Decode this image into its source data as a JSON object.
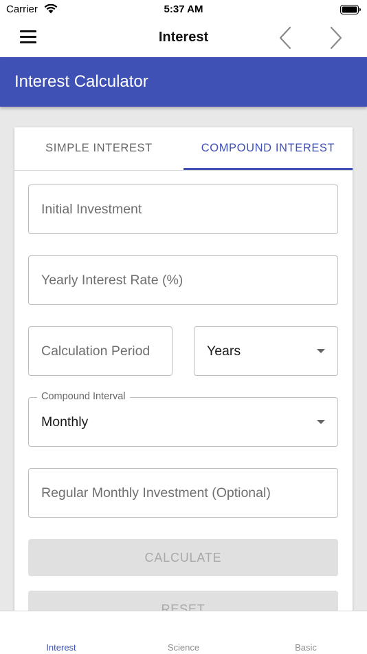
{
  "status_bar": {
    "carrier": "Carrier",
    "time": "5:37 AM",
    "icons": [
      "wifi-icon",
      "battery-icon"
    ]
  },
  "nav_bar": {
    "title": "Interest",
    "icons": [
      "menu-icon",
      "chevron-left-icon",
      "chevron-right-icon"
    ]
  },
  "header": {
    "title": "Interest Calculator",
    "color": "#3f51b5"
  },
  "tabs": {
    "simple": "SIMPLE INTEREST",
    "compound": "COMPOUND INTEREST",
    "active": "COMPOUND INTEREST"
  },
  "form": {
    "initial_investment": {
      "placeholder": "Initial Investment",
      "value": ""
    },
    "yearly_rate": {
      "placeholder": "Yearly Interest Rate (%)",
      "value": ""
    },
    "calculation_period": {
      "placeholder": "Calculation Period",
      "value": ""
    },
    "period_unit": {
      "value": "Years"
    },
    "compound_interval": {
      "label": "Compound Interval",
      "value": "Monthly"
    },
    "monthly_investment": {
      "placeholder": "Regular Monthly Investment (Optional)",
      "value": ""
    }
  },
  "buttons": {
    "calculate": "CALCULATE",
    "reset": "RESET"
  },
  "bottom_tabs": {
    "items": [
      "Interest",
      "Science",
      "Basic"
    ],
    "active": "Interest",
    "active_color": "#3f51b5"
  }
}
